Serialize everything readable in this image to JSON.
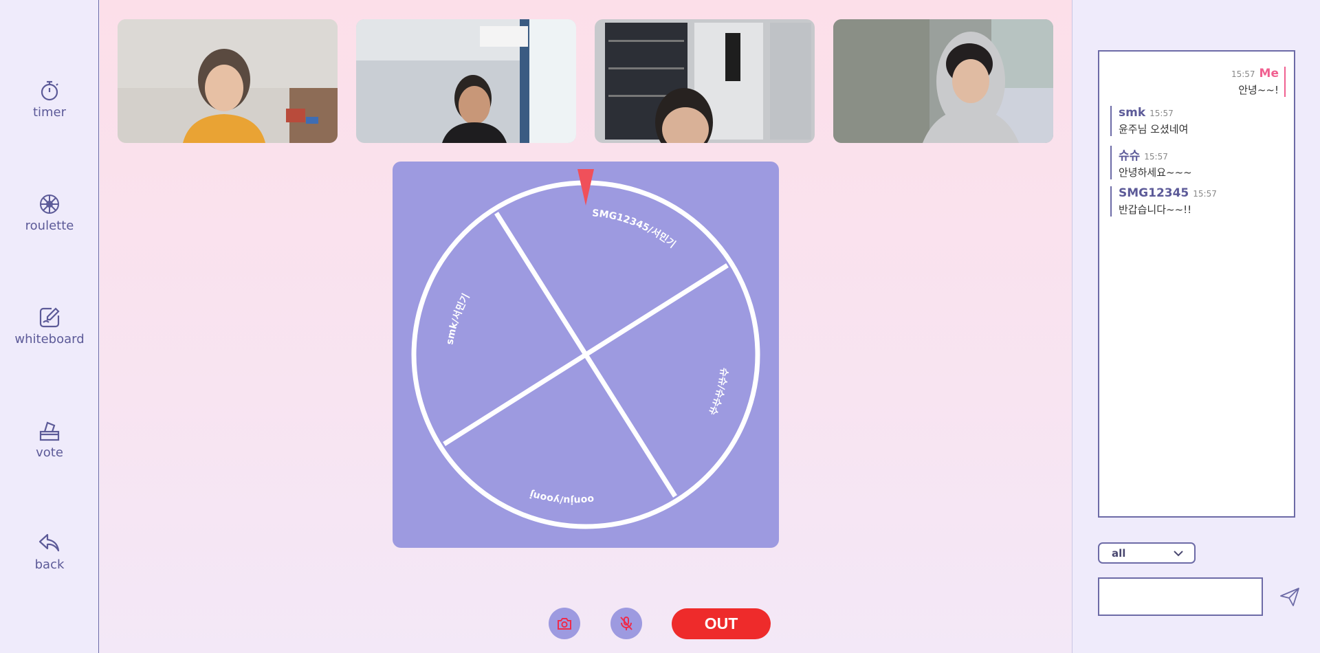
{
  "sidebar": {
    "items": [
      {
        "label": "timer",
        "icon": "stopwatch-icon"
      },
      {
        "label": "roulette",
        "icon": "roulette-wheel-icon"
      },
      {
        "label": "whiteboard",
        "icon": "whiteboard-pen-icon"
      },
      {
        "label": "vote",
        "icon": "ballot-box-icon"
      },
      {
        "label": "back",
        "icon": "back-arrow-icon"
      }
    ]
  },
  "videos": [
    {
      "name": "participant-1"
    },
    {
      "name": "participant-2"
    },
    {
      "name": "participant-3"
    },
    {
      "name": "participant-4"
    }
  ],
  "roulette": {
    "segments": [
      "SMG12345/서민기",
      "슈슈/슈슈슈",
      "yoonju/yoonju",
      "smk/서민기"
    ]
  },
  "controls": {
    "camera_icon": "camera-icon",
    "mic_icon": "microphone-icon",
    "out_label": "OUT"
  },
  "chat": {
    "messages": [
      {
        "sender": "Me",
        "time": "15:57",
        "text": "안녕~~!",
        "mine": true
      },
      {
        "sender": "smk",
        "time": "15:57",
        "text": "윤주님 오셨네여",
        "mine": false
      },
      {
        "sender": "슈슈",
        "time": "15:57",
        "text": "안녕하세요~~~",
        "mine": false
      },
      {
        "sender": "SMG12345",
        "time": "15:57",
        "text": "반갑습니다~~!!",
        "mine": false
      }
    ],
    "recipient": "all",
    "input_value": "",
    "send_icon": "send-paper-plane-icon"
  },
  "colors": {
    "accent": "#9d9ae0",
    "outline": "#6c6aa6",
    "out_button": "#ee2b2b",
    "me_highlight": "#f06090",
    "pointer": "#f0505a"
  }
}
